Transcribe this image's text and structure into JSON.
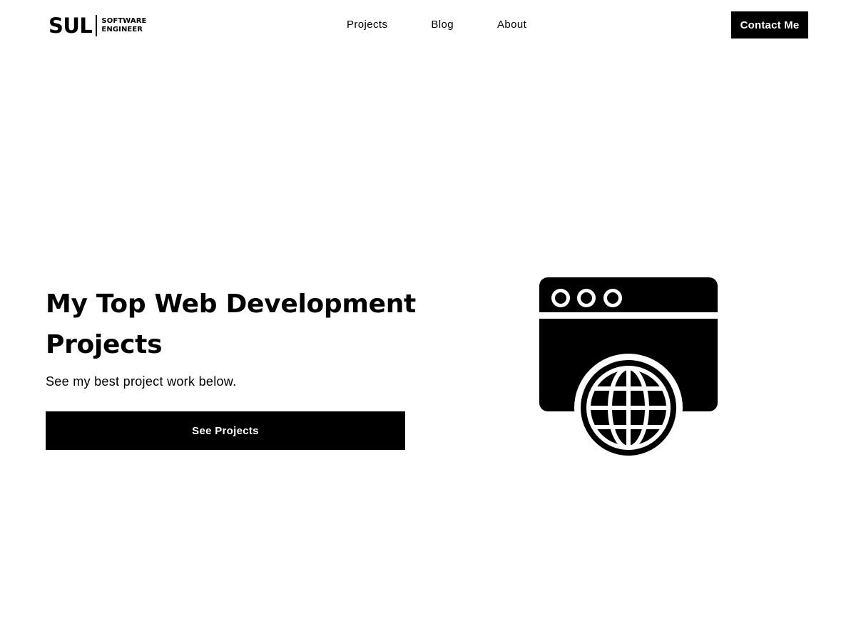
{
  "header": {
    "logo": {
      "mark": "SUL",
      "line1": "SOFTWARE",
      "line2": "ENGINEER"
    },
    "nav": [
      {
        "label": "Projects"
      },
      {
        "label": "Blog"
      },
      {
        "label": "About"
      }
    ],
    "contact_label": "Contact Me"
  },
  "hero": {
    "title": "My Top Web Development Projects",
    "subtitle": "See my best project work below.",
    "cta_label": "See Projects",
    "illustration_icon": "web-browser-globe-icon"
  },
  "colors": {
    "background": "#ffffff",
    "primary": "#000000",
    "button_text": "#ffffff"
  }
}
